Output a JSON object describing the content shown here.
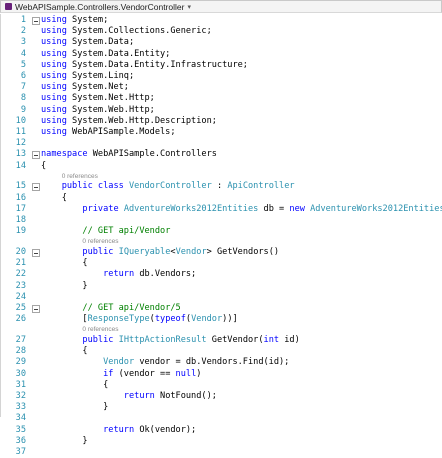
{
  "window": {
    "title": "WebAPISample.Controllers.VendorController"
  },
  "lines": [
    {
      "n": "1",
      "fold": true,
      "tokens": [
        {
          "t": "kw",
          "v": "using"
        },
        {
          "t": "",
          "v": " System;"
        }
      ]
    },
    {
      "n": "2",
      "tokens": [
        {
          "t": "kw",
          "v": "using"
        },
        {
          "t": "",
          "v": " System.Collections.Generic;"
        }
      ]
    },
    {
      "n": "3",
      "tokens": [
        {
          "t": "kw",
          "v": "using"
        },
        {
          "t": "",
          "v": " System.Data;"
        }
      ]
    },
    {
      "n": "4",
      "tokens": [
        {
          "t": "kw",
          "v": "using"
        },
        {
          "t": "",
          "v": " System.Data.Entity;"
        }
      ]
    },
    {
      "n": "5",
      "tokens": [
        {
          "t": "kw",
          "v": "using"
        },
        {
          "t": "",
          "v": " System.Data.Entity.Infrastructure;"
        }
      ]
    },
    {
      "n": "6",
      "tokens": [
        {
          "t": "kw",
          "v": "using"
        },
        {
          "t": "",
          "v": " System.Linq;"
        }
      ]
    },
    {
      "n": "7",
      "tokens": [
        {
          "t": "kw",
          "v": "using"
        },
        {
          "t": "",
          "v": " System.Net;"
        }
      ]
    },
    {
      "n": "8",
      "tokens": [
        {
          "t": "kw",
          "v": "using"
        },
        {
          "t": "",
          "v": " System.Net.Http;"
        }
      ]
    },
    {
      "n": "9",
      "tokens": [
        {
          "t": "kw",
          "v": "using"
        },
        {
          "t": "",
          "v": " System.Web.Http;"
        }
      ]
    },
    {
      "n": "10",
      "tokens": [
        {
          "t": "kw",
          "v": "using"
        },
        {
          "t": "",
          "v": " System.Web.Http.Description;"
        }
      ]
    },
    {
      "n": "11",
      "tokens": [
        {
          "t": "kw",
          "v": "using"
        },
        {
          "t": "",
          "v": " WebAPISample.Models;"
        }
      ]
    },
    {
      "n": "12",
      "tokens": []
    },
    {
      "n": "13",
      "fold": true,
      "tokens": [
        {
          "t": "kw",
          "v": "namespace"
        },
        {
          "t": "",
          "v": " WebAPISample.Controllers"
        }
      ]
    },
    {
      "n": "14",
      "tokens": [
        {
          "t": "",
          "v": "{"
        }
      ]
    },
    {
      "ref": "0 references",
      "indent": "    "
    },
    {
      "n": "15",
      "fold": true,
      "tokens": [
        {
          "t": "",
          "v": "    "
        },
        {
          "t": "kw",
          "v": "public class"
        },
        {
          "t": "",
          "v": " "
        },
        {
          "t": "ty",
          "v": "VendorController"
        },
        {
          "t": "",
          "v": " : "
        },
        {
          "t": "ty",
          "v": "ApiController"
        }
      ]
    },
    {
      "n": "16",
      "tokens": [
        {
          "t": "",
          "v": "    {"
        }
      ]
    },
    {
      "n": "17",
      "tokens": [
        {
          "t": "",
          "v": "        "
        },
        {
          "t": "kw",
          "v": "private"
        },
        {
          "t": "",
          "v": " "
        },
        {
          "t": "ty",
          "v": "AdventureWorks2012Entities"
        },
        {
          "t": "",
          "v": " db = "
        },
        {
          "t": "kw",
          "v": "new"
        },
        {
          "t": "",
          "v": " "
        },
        {
          "t": "ty",
          "v": "AdventureWorks2012Entities"
        },
        {
          "t": "",
          "v": "();"
        }
      ]
    },
    {
      "n": "18",
      "tokens": []
    },
    {
      "n": "19",
      "tokens": [
        {
          "t": "",
          "v": "        "
        },
        {
          "t": "cm",
          "v": "// GET api/Vendor"
        }
      ]
    },
    {
      "ref": "0 references",
      "indent": "        "
    },
    {
      "n": "20",
      "fold": true,
      "tokens": [
        {
          "t": "",
          "v": "        "
        },
        {
          "t": "kw",
          "v": "public"
        },
        {
          "t": "",
          "v": " "
        },
        {
          "t": "ty",
          "v": "IQueryable"
        },
        {
          "t": "",
          "v": "<"
        },
        {
          "t": "ty",
          "v": "Vendor"
        },
        {
          "t": "",
          "v": "> GetVendors()"
        }
      ]
    },
    {
      "n": "21",
      "tokens": [
        {
          "t": "",
          "v": "        {"
        }
      ]
    },
    {
      "n": "22",
      "tokens": [
        {
          "t": "",
          "v": "            "
        },
        {
          "t": "kw",
          "v": "return"
        },
        {
          "t": "",
          "v": " db.Vendors;"
        }
      ]
    },
    {
      "n": "23",
      "tokens": [
        {
          "t": "",
          "v": "        }"
        }
      ]
    },
    {
      "n": "24",
      "tokens": []
    },
    {
      "n": "25",
      "fold": true,
      "tokens": [
        {
          "t": "",
          "v": "        "
        },
        {
          "t": "cm",
          "v": "// GET api/Vendor/5"
        }
      ]
    },
    {
      "n": "26",
      "tokens": [
        {
          "t": "",
          "v": "        ["
        },
        {
          "t": "ty",
          "v": "ResponseType"
        },
        {
          "t": "",
          "v": "("
        },
        {
          "t": "kw",
          "v": "typeof"
        },
        {
          "t": "",
          "v": "("
        },
        {
          "t": "ty",
          "v": "Vendor"
        },
        {
          "t": "",
          "v": "))]"
        }
      ]
    },
    {
      "ref": "0 references",
      "indent": "        "
    },
    {
      "n": "27",
      "tokens": [
        {
          "t": "",
          "v": "        "
        },
        {
          "t": "kw",
          "v": "public"
        },
        {
          "t": "",
          "v": " "
        },
        {
          "t": "ty",
          "v": "IHttpActionResult"
        },
        {
          "t": "",
          "v": " GetVendor("
        },
        {
          "t": "kw",
          "v": "int"
        },
        {
          "t": "",
          "v": " id)"
        }
      ]
    },
    {
      "n": "28",
      "tokens": [
        {
          "t": "",
          "v": "        {"
        }
      ]
    },
    {
      "n": "29",
      "tokens": [
        {
          "t": "",
          "v": "            "
        },
        {
          "t": "ty",
          "v": "Vendor"
        },
        {
          "t": "",
          "v": " vendor = db.Vendors.Find(id);"
        }
      ]
    },
    {
      "n": "30",
      "tokens": [
        {
          "t": "",
          "v": "            "
        },
        {
          "t": "kw",
          "v": "if"
        },
        {
          "t": "",
          "v": " (vendor == "
        },
        {
          "t": "kw",
          "v": "null"
        },
        {
          "t": "",
          "v": ")"
        }
      ]
    },
    {
      "n": "31",
      "tokens": [
        {
          "t": "",
          "v": "            {"
        }
      ]
    },
    {
      "n": "32",
      "tokens": [
        {
          "t": "",
          "v": "                "
        },
        {
          "t": "kw",
          "v": "return"
        },
        {
          "t": "",
          "v": " NotFound();"
        }
      ]
    },
    {
      "n": "33",
      "tokens": [
        {
          "t": "",
          "v": "            }"
        }
      ]
    },
    {
      "n": "34",
      "tokens": []
    },
    {
      "n": "35",
      "tokens": [
        {
          "t": "",
          "v": "            "
        },
        {
          "t": "kw",
          "v": "return"
        },
        {
          "t": "",
          "v": " Ok(vendor);"
        }
      ]
    },
    {
      "n": "36",
      "tokens": [
        {
          "t": "",
          "v": "        }"
        }
      ]
    },
    {
      "n": "37",
      "tokens": []
    }
  ],
  "colors": {
    "keyword": "#0000ff",
    "type": "#2b91af",
    "comment": "#008000",
    "line_number": "#2b91af",
    "codelens": "#8a8a8a"
  }
}
